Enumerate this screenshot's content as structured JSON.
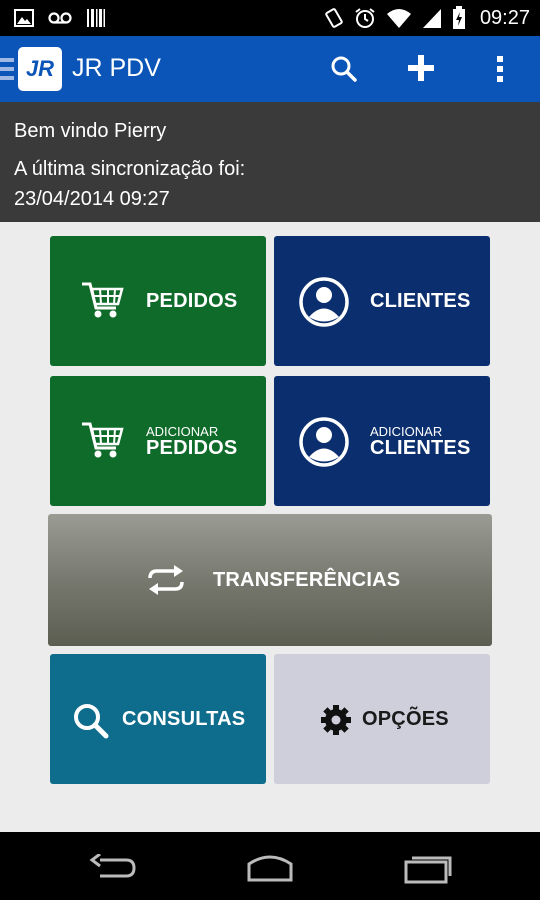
{
  "status_bar": {
    "time": "09:27",
    "left_icons": [
      "image-icon",
      "voicemail-icon",
      "barcode-icon"
    ],
    "right_icons": [
      "vibrate-icon",
      "alarm-icon",
      "wifi-icon",
      "signal-icon",
      "battery-icon"
    ]
  },
  "action_bar": {
    "logo_text": "JR",
    "title": "JR PDV",
    "actions": [
      "search-icon",
      "add-icon",
      "overflow-menu-icon"
    ],
    "color": "#0b55b8"
  },
  "welcome": {
    "greeting": "Bem vindo Pierry",
    "sync_label": "A última sincronização foi:",
    "sync_datetime": "23/04/2014 09:27"
  },
  "tiles": {
    "pedidos": {
      "label": "PEDIDOS",
      "icon": "cart-icon",
      "color": "#0f6b2a"
    },
    "clientes": {
      "label": "CLIENTES",
      "icon": "user-icon",
      "color": "#0b2f6e"
    },
    "add_pedidos": {
      "small": "ADICIONAR",
      "label": "PEDIDOS",
      "icon": "cart-icon",
      "color": "#0f6b2a"
    },
    "add_clientes": {
      "small": "ADICIONAR",
      "label": "CLIENTES",
      "icon": "user-icon",
      "color": "#0b2f6e"
    },
    "transferencias": {
      "label": "TRANSFERÊNCIAS",
      "icon": "sync-arrows-icon",
      "color": "#74766c"
    },
    "consultas": {
      "label": "CONSULTAS",
      "icon": "search-icon",
      "color": "#0e6c8c"
    },
    "opcoes": {
      "label": "OPÇÕES",
      "icon": "gear-icon",
      "color": "#cfcfdc"
    }
  },
  "nav_bar": {
    "buttons": [
      "back-icon",
      "home-icon",
      "recent-apps-icon"
    ]
  }
}
